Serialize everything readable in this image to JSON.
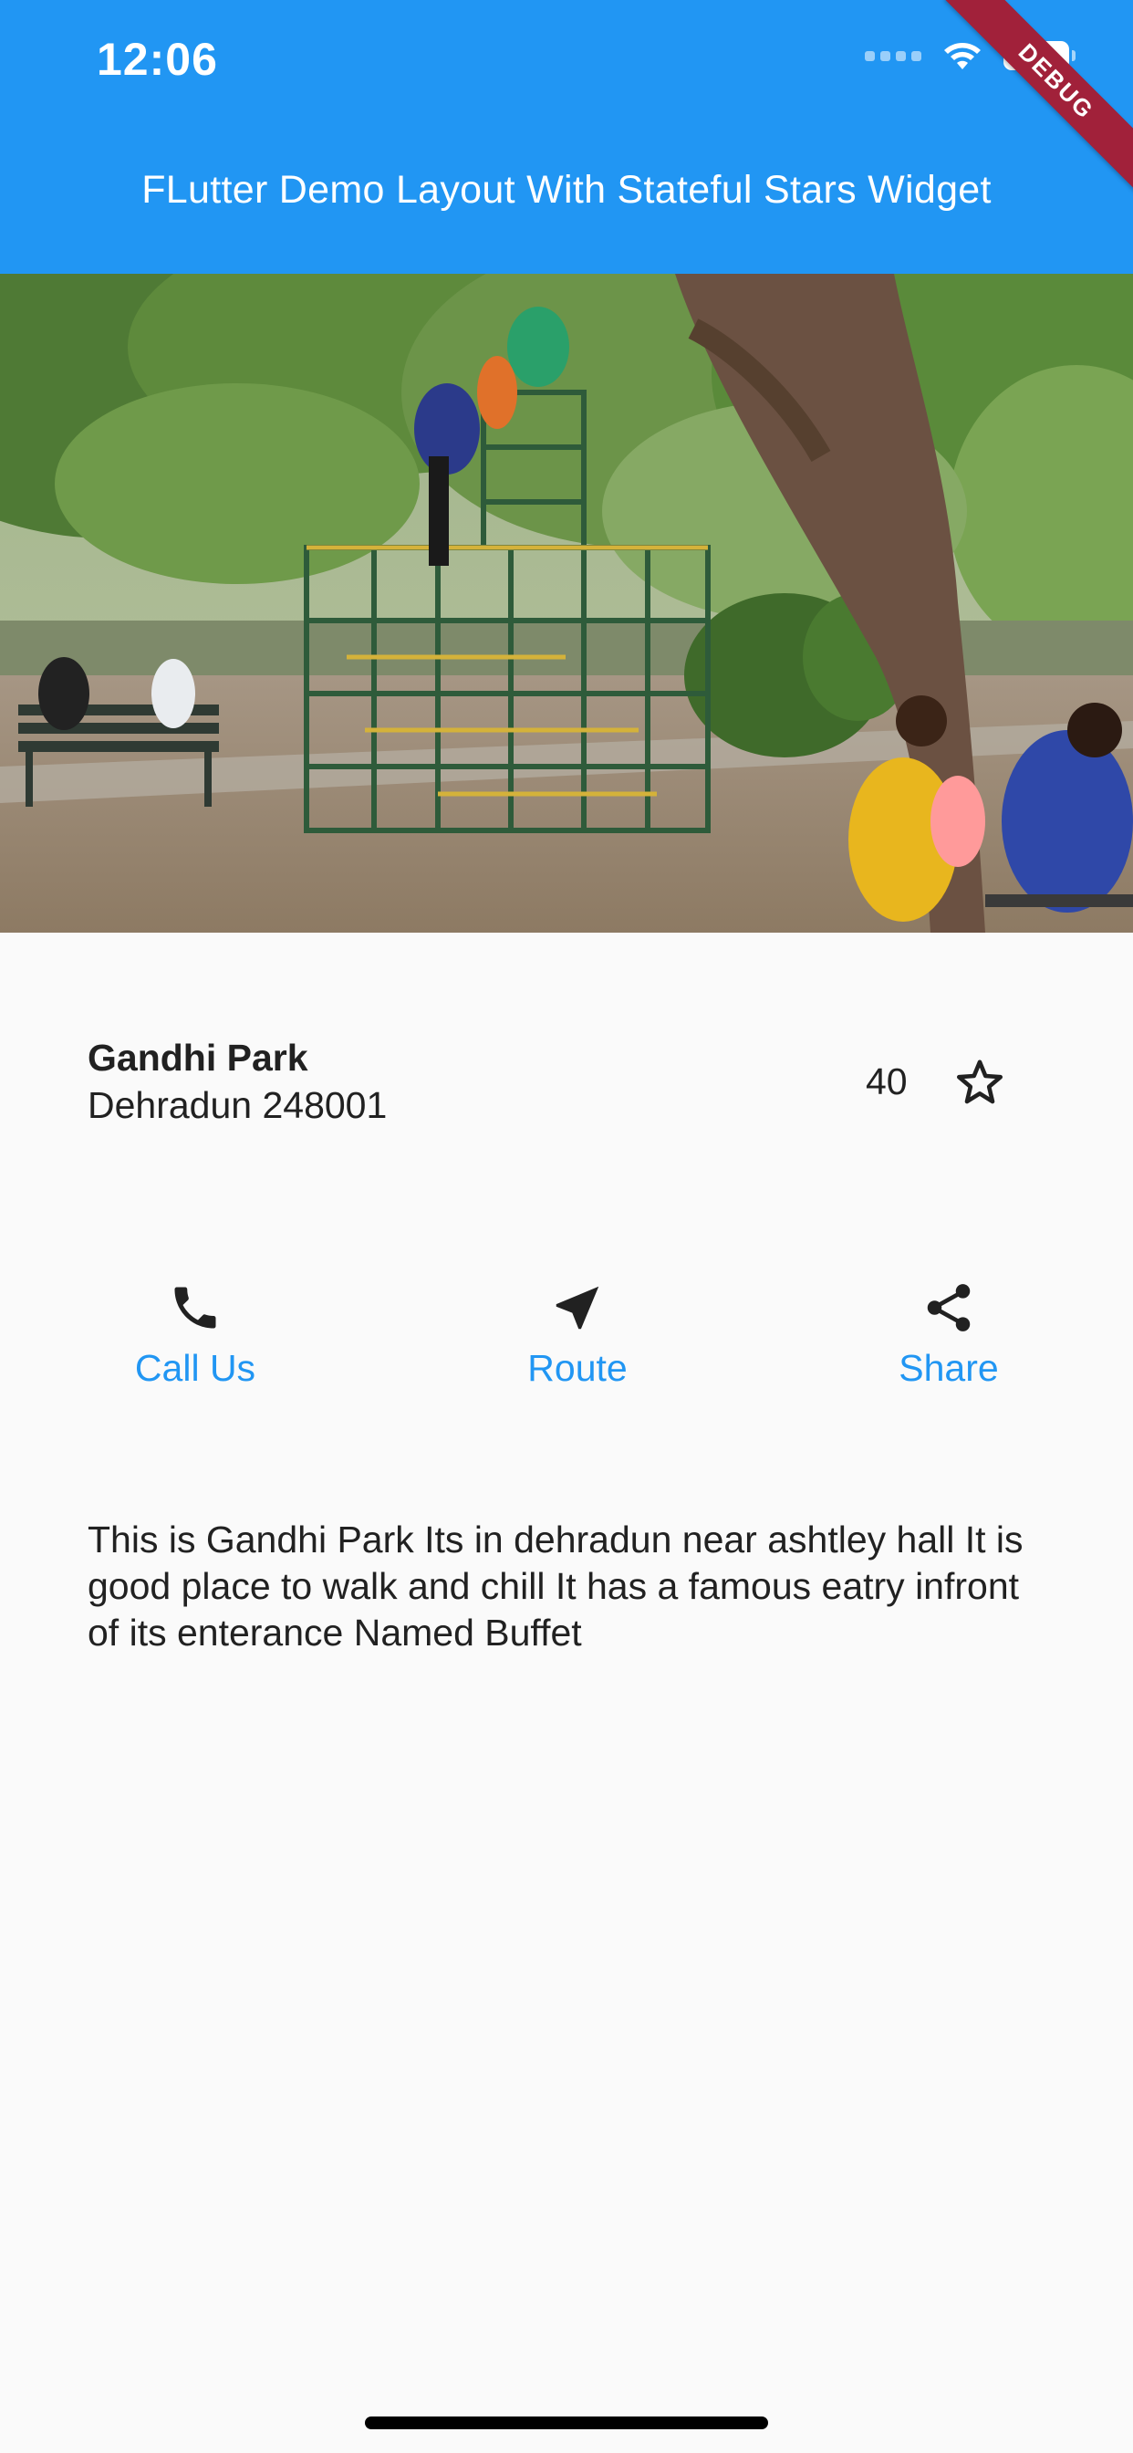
{
  "status_bar": {
    "time": "12:06",
    "debug_banner": "DEBUG"
  },
  "app_bar": {
    "title": "FLutter Demo Layout With Stateful Stars Widget"
  },
  "colors": {
    "primary": "#2196f3",
    "background": "#fafafa",
    "text": "#212121",
    "debug_banner": "#a1213a"
  },
  "park": {
    "name": "Gandhi Park",
    "address": "Dehradun 248001",
    "star_count": "40",
    "star_icon": "star-outline-icon"
  },
  "actions": [
    {
      "label": "Call Us",
      "icon": "phone-icon"
    },
    {
      "label": "Route",
      "icon": "navigation-icon"
    },
    {
      "label": "Share",
      "icon": "share-icon"
    }
  ],
  "description": "This is Gandhi Park Its in dehradun near ashtley hall It is good place to walk and chill It has a famous eatry infront of its enterance Named Buffet"
}
